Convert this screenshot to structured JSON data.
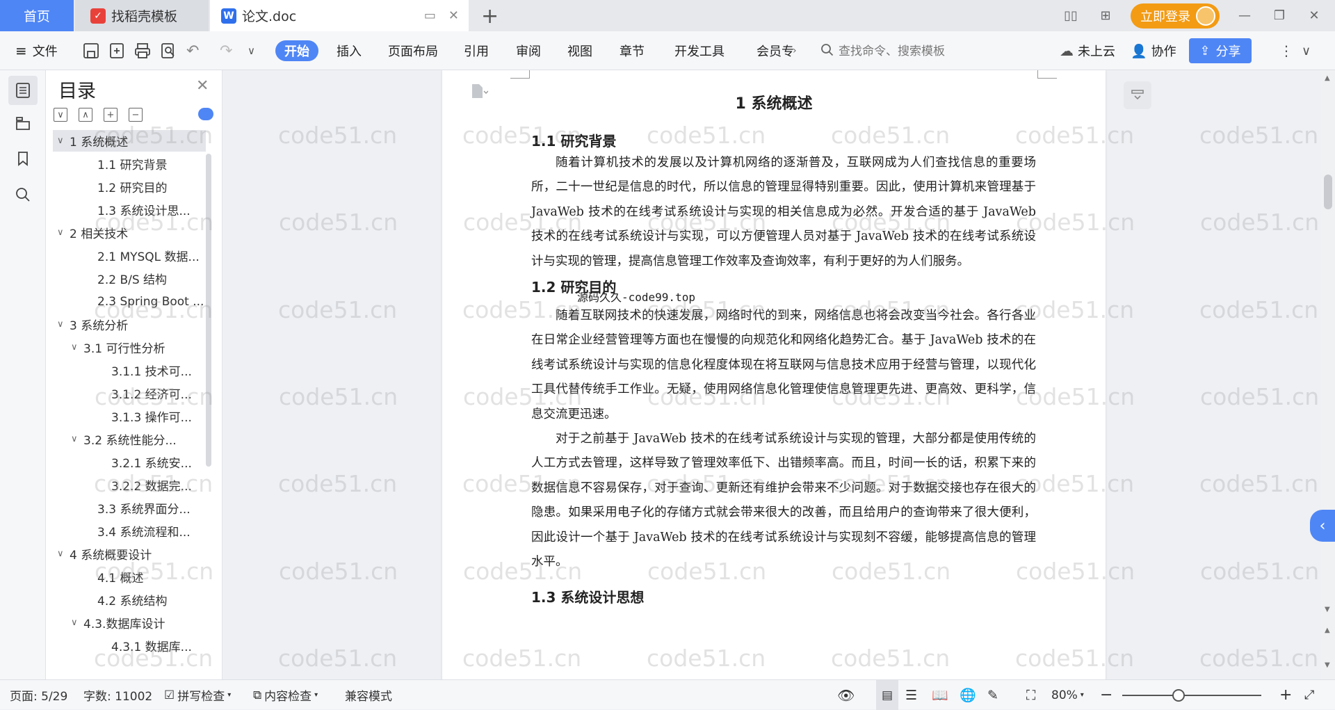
{
  "titlebar": {
    "tab_home": "首页",
    "tab_template": "找稻壳模板",
    "tab_doc": "论文.doc",
    "new_tab": "+",
    "login": "立即登录"
  },
  "ribbon": {
    "menu_file": "文件",
    "start": "开始",
    "tabs": [
      "插入",
      "页面布局",
      "引用",
      "审阅",
      "视图",
      "章节",
      "开发工具",
      "会员专"
    ],
    "search_placeholder": "查找命令、搜索模板",
    "cloud": "未上云",
    "collab": "协作",
    "share": "分享"
  },
  "toc": {
    "title": "目录",
    "items": [
      {
        "label": "1 系统概述",
        "caret": "∨"
      },
      {
        "label": "1.1  研究背景",
        "caret": ""
      },
      {
        "label": "1.2 研究目的",
        "caret": ""
      },
      {
        "label": "1.3 系统设计思...",
        "caret": ""
      },
      {
        "label": "2 相关技术",
        "caret": "∨"
      },
      {
        "label": "2.1 MYSQL 数据...",
        "caret": ""
      },
      {
        "label": "2.2 B/S 结构",
        "caret": ""
      },
      {
        "label": "2.3 Spring Boot ...",
        "caret": ""
      },
      {
        "label": "3 系统分析",
        "caret": "∨"
      },
      {
        "label": "3.1 可行性分析",
        "caret": "∨"
      },
      {
        "label": "3.1.1 技术可...",
        "caret": ""
      },
      {
        "label": "3.1.2 经济可...",
        "caret": ""
      },
      {
        "label": "3.1.3 操作可...",
        "caret": ""
      },
      {
        "label": "3.2 系统性能分...",
        "caret": "∨"
      },
      {
        "label": "3.2.1  系统安...",
        "caret": ""
      },
      {
        "label": "3.2.2  数据完...",
        "caret": ""
      },
      {
        "label": "3.3 系统界面分...",
        "caret": ""
      },
      {
        "label": "3.4 系统流程和...",
        "caret": ""
      },
      {
        "label": "4 系统概要设计",
        "caret": "∨"
      },
      {
        "label": "4.1 概述",
        "caret": ""
      },
      {
        "label": "4.2 系统结构",
        "caret": ""
      },
      {
        "label": "4.3.数据库设计",
        "caret": "∨"
      },
      {
        "label": "4.3.1 数据库...",
        "caret": ""
      }
    ]
  },
  "document": {
    "h1": "1 系统概述",
    "s1_title": "1.1  研究背景",
    "s1_p1": "随着计算机技术的发展以及计算机网络的逐渐普及，互联网成为人们查找信息的重要场所，二十一世纪是信息的时代，所以信息的管理显得特别重要。因此，使用计算机来管理基于 JavaWeb 技术的在线考试系统设计与实现的相关信息成为必然。开发合适的基于 JavaWeb 技术的在线考试系统设计与实现，可以方便管理人员对基于 JavaWeb 技术的在线考试系统设计与实现的管理，提高信息管理工作效率及查询效率，有利于更好的为人们服务。",
    "s2_title": "1.2 研究目的",
    "overlay": "源码久久-code99.top",
    "s2_p1": "随着互联网技术的快速发展，网络时代的到来，网络信息也将会改变当今社会。各行各业在日常企业经营管理等方面也在慢慢的向规范化和网络化趋势汇合。基于 JavaWeb 技术的在线考试系统设计与实现的信息化程度体现在将互联网与信息技术应用于经营与管理，以现代化工具代替传统手工作业。无疑，使用网络信息化管理使信息管理更先进、更高效、更科学，信息交流更迅速。",
    "s2_p2": "对于之前基于 JavaWeb 技术的在线考试系统设计与实现的管理，大部分都是使用传统的人工方式去管理，这样导致了管理效率低下、出错频率高。而且，时间一长的话，积累下来的数据信息不容易保存，对于查询、更新还有维护会带来不少问题。对于数据交接也存在很大的隐患。如果采用电子化的存储方式就会带来很大的改善，而且给用户的查询带来了很大便利，因此设计一个基于 JavaWeb 技术的在线考试系统设计与实现刻不容缓，能够提高信息的管理水平。",
    "s3_title": "1.3 系统设计思想"
  },
  "status": {
    "page": "页面: 5/29",
    "words": "字数: 11002",
    "spell": "拼写检查",
    "content": "内容检查",
    "compat": "兼容模式",
    "zoom": "80%"
  },
  "watermark": "code51.cn",
  "colors": {
    "accent": "#4f86f5",
    "login": "#f39b13"
  }
}
